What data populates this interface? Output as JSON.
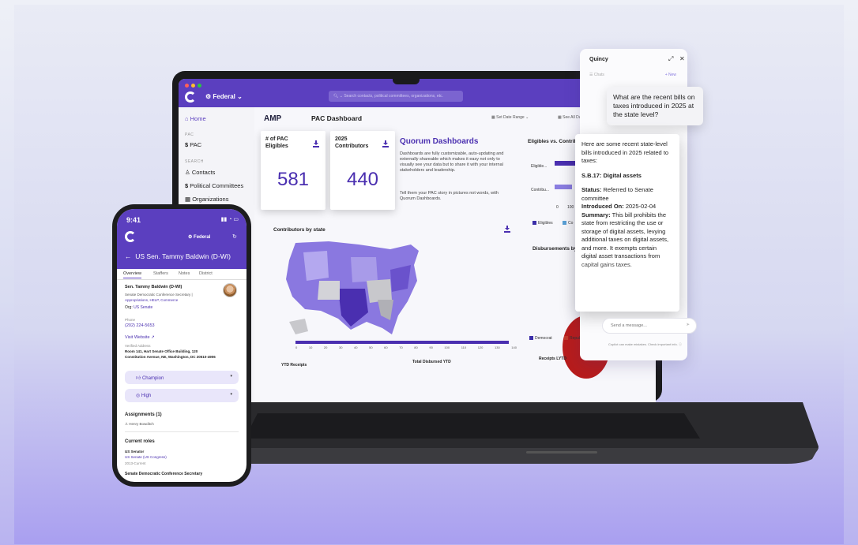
{
  "laptop": {
    "org_switch": "Federal",
    "search_placeholder": "Search contacts, political committees, organizations, etc.",
    "sidebar": {
      "home": "Home",
      "sec_pac": "PAC",
      "pac": "PAC",
      "sec_search": "SEARCH",
      "contacts": "Contacts",
      "political_committees": "Political Committees",
      "organizations": "Organizations"
    },
    "header": {
      "amp": "AMP",
      "title": "PAC Dashboard",
      "date_range": "Set Date Range",
      "see_all": "See All Dashboards"
    },
    "cards": [
      {
        "label": "# of PAC Eligibles",
        "value": "581"
      },
      {
        "label": "2025 Contributors",
        "value": "440"
      }
    ],
    "promo": {
      "title": "Quorum Dashboards",
      "text": "Dashboards are fully customizable, auto-updating and externally shareable which makes it easy not only to visually see your data but to share it with your internal stakeholders and leadership.",
      "text2": "Tell them your PAC story in pictures not words, with Quorum Dashboards."
    },
    "eligibles_chart": {
      "title": "Eligibles vs. Contrib",
      "rows": [
        "Eligible...",
        "Contribu..."
      ],
      "ticks": [
        "0",
        "100"
      ],
      "legend": [
        "Eligibles",
        "Co"
      ]
    },
    "map_title": "Contributors by state",
    "timeline_ticks": [
      "0",
      "10",
      "20",
      "30",
      "40",
      "50",
      "60",
      "70",
      "80",
      "90",
      "100",
      "110",
      "120",
      "130",
      "140"
    ],
    "disbursements_title": "Disbursements by P",
    "party_legend": [
      "Democrat",
      "Republi"
    ],
    "bottom": [
      "YTD Receipts",
      "Total Disbursed YTD",
      "Receipts LYTD"
    ]
  },
  "quincy": {
    "title": "Quincy",
    "chats": "Chats",
    "new": "+ New",
    "question": "What are the recent bills on taxes introduced in 2025 at the state level?",
    "answer_intro": "Here are some recent state-level bills introduced in 2025 related to taxes:",
    "bill": "S.B.17: Digital assets",
    "status_label": "Status:",
    "status": "Referred to Senate committee",
    "introduced_label": "Introduced On:",
    "introduced": "2025-02-04",
    "summary_label": "Summary:",
    "summary": "This bill prohibits the state from restricting the use or storage of digital assets, levying additional taxes on digital assets, and more. It exempts certain digital asset transactions from capital gains taxes.",
    "input_placeholder": "Send a message...",
    "disclaimer": "Copilot can make mistakes. Check important info."
  },
  "phone": {
    "time": "9:41",
    "org_switch": "Federal",
    "title": "US Sen. Tammy Baldwin (D-WI)",
    "tabs": [
      "Overview",
      "Staffers",
      "Notes",
      "District"
    ],
    "name": "Sen. Tammy Baldwin (D-WI)",
    "role": "Senate Democratic Conference Secretary |",
    "committees": "Appropriations, HELP, Commerce",
    "org_label": "Org:",
    "org": "US Senate",
    "phone_label": "Phone",
    "phone": "(202) 224-5653",
    "website": "Visit Website",
    "address_label": "Verified Address",
    "address1": "Room 141, Hart Senate Office Building, 120",
    "address2": "Constitution Avenue, NE, Washington, DC 20510-4906",
    "stance": "Champion",
    "priority": "High",
    "assignments_title": "Assignments (1)",
    "assignee": "Henry Bowditch",
    "roles_title": "Current roles",
    "role1": "US Senator",
    "role1_org": "US Senate (US Congress)",
    "role1_years": "2013-Current",
    "role2": "Senate Democratic Conference Secretary"
  },
  "colors": {
    "brand": "#5b3fbf",
    "accent": "#4a2fb0",
    "democrat": "#3b2ea8",
    "republican": "#c0392b"
  }
}
